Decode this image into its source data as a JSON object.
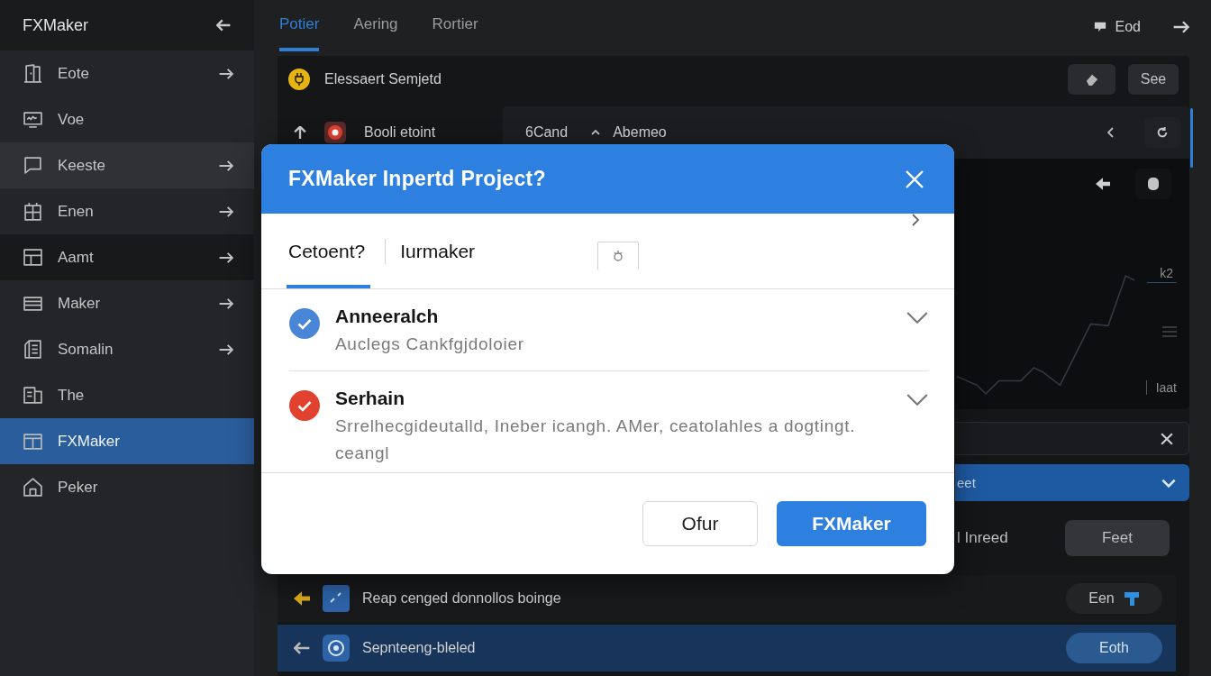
{
  "sidebar": {
    "title": "FXMaker",
    "items": [
      {
        "label": "Eote",
        "selected": false,
        "hovered": false,
        "pressed": false,
        "has_submenu": true
      },
      {
        "label": "Voe",
        "selected": false,
        "hovered": false,
        "pressed": false,
        "has_submenu": false
      },
      {
        "label": "Keeste",
        "selected": false,
        "hovered": true,
        "pressed": false,
        "has_submenu": true
      },
      {
        "label": "Enen",
        "selected": false,
        "hovered": false,
        "pressed": false,
        "has_submenu": true
      },
      {
        "label": "Aamt",
        "selected": false,
        "hovered": false,
        "pressed": true,
        "has_submenu": true
      },
      {
        "label": "Maker",
        "selected": false,
        "hovered": false,
        "pressed": false,
        "has_submenu": true
      },
      {
        "label": "Somalin",
        "selected": false,
        "hovered": false,
        "pressed": false,
        "has_submenu": true
      },
      {
        "label": "The",
        "selected": false,
        "hovered": false,
        "pressed": false,
        "has_submenu": false
      },
      {
        "label": "FXMaker",
        "selected": true,
        "hovered": false,
        "pressed": false,
        "has_submenu": false
      },
      {
        "label": "Peker",
        "selected": false,
        "hovered": false,
        "pressed": false,
        "has_submenu": false
      }
    ]
  },
  "top_bar": {
    "tabs": [
      {
        "label": "Potier",
        "selected": true
      },
      {
        "label": "Aering",
        "selected": false
      },
      {
        "label": "Rortier",
        "selected": false
      }
    ],
    "account_label": "Eod"
  },
  "panel": {
    "header": {
      "title": "Elessaert Semjetd",
      "button": "See"
    },
    "source": {
      "title": "Booli etoint",
      "field_1": "6Cand",
      "field_2": "Abemeo"
    },
    "chart_labels": [
      "k2",
      "Iaat"
    ],
    "dropdown": {
      "value": "eet"
    },
    "option": {
      "label": "l Inreed",
      "button": "Feet"
    },
    "rows": [
      {
        "title": "Reap cenged donnollos boinge",
        "button": "Een",
        "selected": false
      },
      {
        "title": "Sepnteeng-bleled",
        "button": "Eoth",
        "selected": true
      }
    ]
  },
  "dialog": {
    "title": "FXMaker Inpertd Project?",
    "tabs": [
      {
        "label": "Cetoent?",
        "selected": true
      },
      {
        "label": "Iurmaker",
        "selected": false
      }
    ],
    "items": [
      {
        "title": "Anneeralch",
        "description": "Auclegs Cankfgjdoloier",
        "color": "#4a86d8",
        "checked": true,
        "expanded": false
      },
      {
        "title": "Serhain",
        "description": "Srrelhecgideutalld, Ineber icangh. AMer, ceatolahles a dogtingt. ceangl",
        "color": "#e0422f",
        "checked": true,
        "expanded": false
      }
    ],
    "buttons": [
      {
        "label": "Ofur",
        "kind": "secondary"
      },
      {
        "label": "FXMaker",
        "kind": "primary"
      }
    ]
  }
}
